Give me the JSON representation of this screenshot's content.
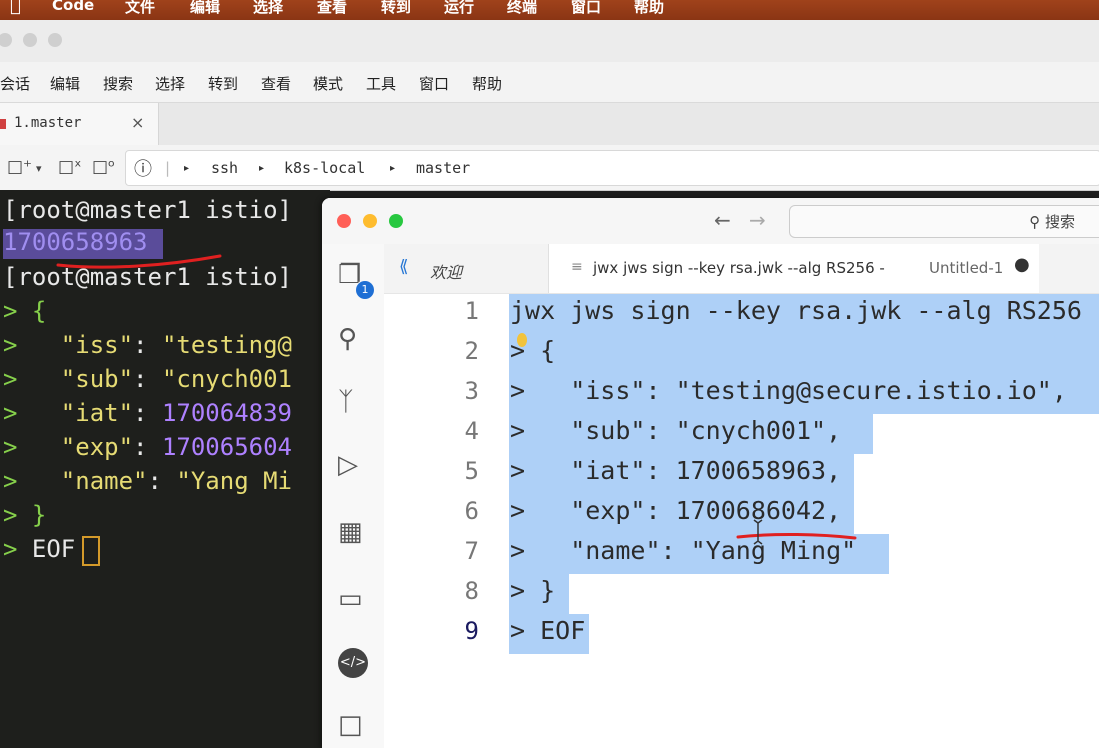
{
  "menubar": {
    "app": "Code",
    "items": [
      "文件",
      "编辑",
      "选择",
      "查看",
      "转到",
      "运行",
      "终端",
      "窗口",
      "帮助"
    ]
  },
  "terminal": {
    "menu": [
      "会话",
      "编辑",
      "搜索",
      "选择",
      "转到",
      "查看",
      "模式",
      "工具",
      "窗口",
      "帮助"
    ],
    "tab_label": "1.master",
    "tab_close": "×",
    "breadcrumbs": [
      "ssh",
      "k8s-local",
      "master"
    ],
    "lines": {
      "l1": "[root@master1 istio]",
      "l2": "1700658963",
      "l3": "[root@master1 istio]",
      "l4": "> {",
      "l5a": ">   ",
      "l5b": "\"iss\"",
      "l5c": ": ",
      "l5d": "\"testing@",
      "l6a": ">   ",
      "l6b": "\"sub\"",
      "l6c": ": ",
      "l6d": "\"cnych001",
      "l7a": ">   ",
      "l7b": "\"iat\"",
      "l7c": ": ",
      "l7d": "170064839",
      "l8a": ">   ",
      "l8b": "\"exp\"",
      "l8c": ": ",
      "l8d": "170065604",
      "l9a": ">   ",
      "l9b": "\"name\"",
      "l9c": ": ",
      "l9d": "\"Yang Mi",
      "l10": "> }",
      "l11a": "> ",
      "l11b": "EOF"
    }
  },
  "vscode": {
    "search_placeholder": "搜索",
    "activity_badge": "1",
    "tab_welcome": "欢迎",
    "tab_active_label": "jwx jws sign --key rsa.jwk --alg RS256 -",
    "tab_active_sub": "Untitled-1",
    "tab_dirty": "●",
    "line_numbers": [
      "1",
      "2",
      "3",
      "4",
      "5",
      "6",
      "7",
      "8",
      "9"
    ],
    "code": [
      "jwx jws sign --key rsa.jwk --alg RS256",
      "> {",
      ">   \"iss\": \"testing@secure.istio.io\",",
      ">   \"sub\": \"cnych001\",",
      ">   \"iat\": 1700658963,",
      ">   \"exp\": 1700686042,",
      ">   \"name\": \"Yang Ming\"",
      "> }",
      "> EOF"
    ]
  },
  "colors": {
    "menubar": "#9a3c17",
    "terminal_bg": "#1e1f1c",
    "prompt_green": "#86d04b",
    "string_yellow": "#e6db74",
    "number_purple": "#ae81ff",
    "selection_blue": "#aed0f7",
    "annotation_red": "#e02020"
  }
}
